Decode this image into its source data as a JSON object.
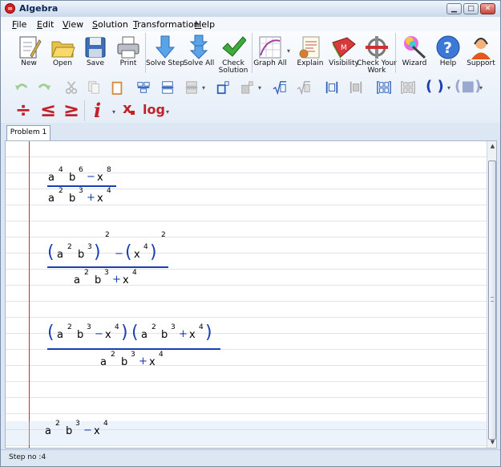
{
  "window": {
    "title": "Algebra",
    "minimize": "▁",
    "maximize": "□",
    "close": "✕"
  },
  "menu": [
    "File",
    "Edit",
    "View",
    "Solution",
    "Transformation",
    "Help"
  ],
  "toolbar": {
    "new": "New",
    "open": "Open",
    "save": "Save",
    "print": "Print",
    "solve_step": "Solve Step",
    "solve_all": "Solve All",
    "check_solution": "Check Solution",
    "graph_all": "Graph All",
    "explain": "Explain",
    "visibility": "Visibility",
    "check_work": "Check Your Work",
    "wizard": "Wizard",
    "help": "Help",
    "support": "Support",
    "visibility_letter": "M",
    "help_glyph": "?"
  },
  "format_bar": {
    "divide": "÷",
    "le": "≤",
    "ge": "≥",
    "imag": "i",
    "subscript": "x",
    "log": "log",
    "paren": "( )"
  },
  "tabs": [
    "Problem 1"
  ],
  "steps": [
    {
      "num": [
        "a",
        "4",
        "b",
        "6",
        "−",
        "x",
        "8"
      ],
      "den": [
        "a",
        "2",
        "b",
        "3",
        "+",
        "x",
        "4"
      ]
    },
    {
      "num": [
        "(",
        "a",
        "2",
        "b",
        "3",
        ")",
        "2",
        "−",
        "(",
        "x",
        "4",
        ")",
        "2"
      ],
      "den": [
        "a",
        "2",
        "b",
        "3",
        "+",
        "x",
        "4"
      ]
    },
    {
      "num": [
        "(",
        "a",
        "2",
        "b",
        "3",
        "−",
        "x",
        "4",
        ")",
        "(",
        "a",
        "2",
        "b",
        "3",
        "+",
        "x",
        "4",
        ")"
      ],
      "den": [
        "a",
        "2",
        "b",
        "3",
        "+",
        "x",
        "4"
      ]
    },
    {
      "expr": [
        "a",
        "2",
        "b",
        "3",
        "−",
        "x",
        "4"
      ]
    }
  ],
  "status": "Step no :4"
}
